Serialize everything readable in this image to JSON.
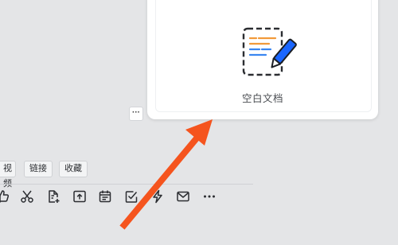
{
  "card": {
    "label": "空白文档",
    "icon": "blank-document-pen-icon"
  },
  "more_button": {
    "label": "···",
    "icon": "ellipsis-icon"
  },
  "tags": [
    {
      "label": "视频"
    },
    {
      "label": "链接"
    },
    {
      "label": "收藏"
    }
  ],
  "toolbar": {
    "icons": [
      "thumbs-up-icon",
      "scissors-icon",
      "document-add-icon",
      "upload-icon",
      "calendar-icon",
      "checkbox-icon",
      "lightning-icon",
      "mail-icon",
      "more-horizontal-icon"
    ],
    "more_label": "···"
  },
  "colors": {
    "background": "#e4e5e7",
    "arrow": "#f5541e",
    "doc_pen": "#1a66ff",
    "doc_line_orange": "#f29a3a",
    "doc_line_blue": "#3a86f0"
  }
}
